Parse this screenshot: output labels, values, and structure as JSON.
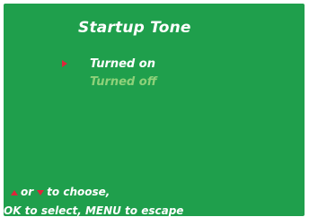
{
  "screen": {
    "title": "Startup Tone",
    "background_color": "#1f9f4c"
  },
  "menu": {
    "options": [
      {
        "label": "Turned on",
        "selected": true
      },
      {
        "label": "Turned off",
        "selected": false
      }
    ],
    "cursor_icon": "right-arrow",
    "cursor_color": "#e0243a"
  },
  "help": {
    "line1_or": "or",
    "line1_suffix": "to choose,",
    "line2": "OK to select, MENU to escape",
    "up_icon": "up-arrow",
    "down_icon": "down-arrow"
  }
}
